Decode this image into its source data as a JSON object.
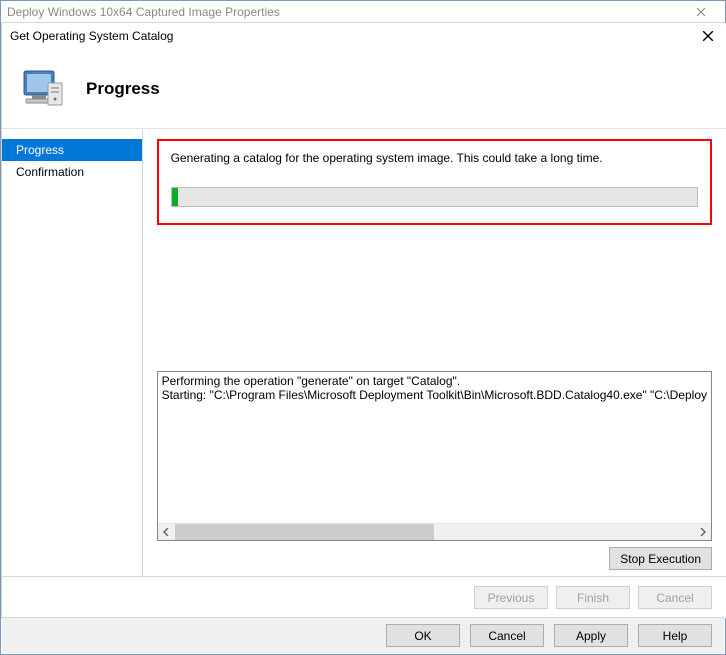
{
  "outer": {
    "title": "Deploy Windows 10x64 Captured Image Properties",
    "buttons": {
      "ok": "OK",
      "cancel": "Cancel",
      "apply": "Apply",
      "help": "Help"
    }
  },
  "inner": {
    "title": "Get Operating System Catalog",
    "header": "Progress",
    "sidebar": {
      "items": [
        "Progress",
        "Confirmation"
      ],
      "selected": 0
    },
    "status": "Generating a catalog for the operating system image.  This could take a long time.",
    "progress_percent": 1,
    "log": "Performing the operation \"generate\" on target \"Catalog\".\nStarting: \"C:\\Program Files\\Microsoft Deployment Toolkit\\Bin\\Microsoft.BDD.Catalog40.exe\" \"C:\\Deploy",
    "stop_button": "Stop Execution",
    "footer": {
      "previous": "Previous",
      "finish": "Finish",
      "cancel": "Cancel"
    }
  }
}
